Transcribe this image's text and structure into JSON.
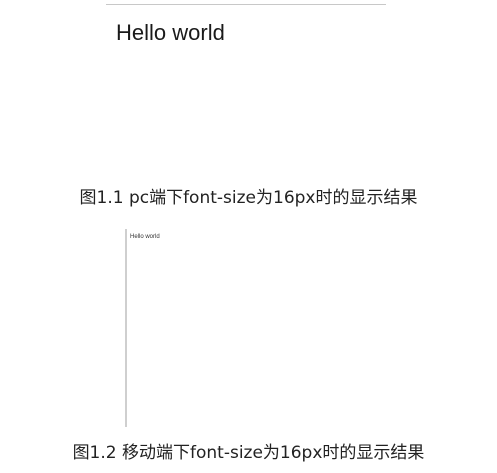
{
  "figure1": {
    "sample_text": "Hello world",
    "caption": "图1.1 pc端下font-size为16px时的显示结果"
  },
  "figure2": {
    "sample_text": "Hello world",
    "caption": "图1.2 移动端下font-size为16px时的显示结果"
  }
}
